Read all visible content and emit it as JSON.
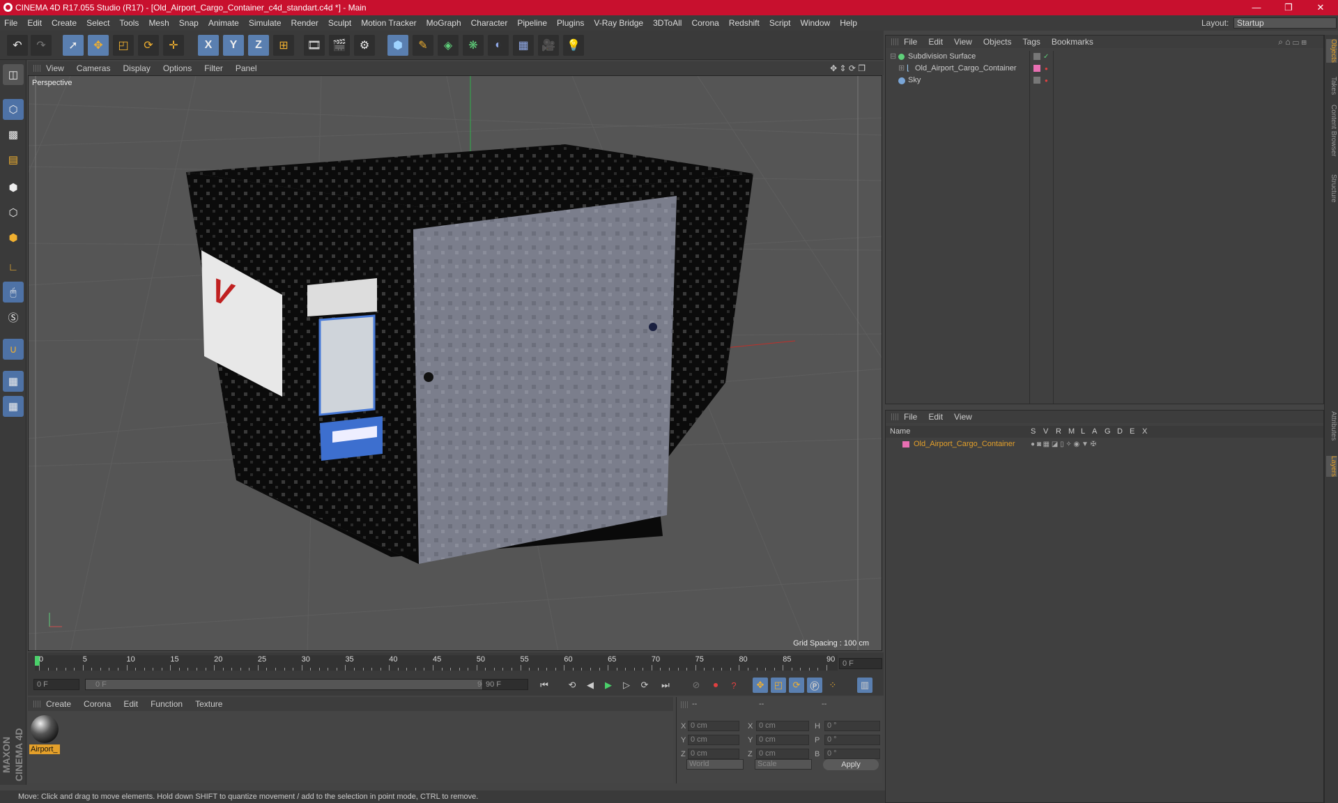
{
  "window": {
    "title": "CINEMA 4D R17.055 Studio (R17) - [Old_Airport_Cargo_Container_c4d_standart.c4d *] - Main",
    "minimize": "—",
    "restore": "❐",
    "close": "✕"
  },
  "menu": [
    "File",
    "Edit",
    "Create",
    "Select",
    "Tools",
    "Mesh",
    "Snap",
    "Animate",
    "Simulate",
    "Render",
    "Sculpt",
    "Motion Tracker",
    "MoGraph",
    "Character",
    "Pipeline",
    "Plugins",
    "V-Ray Bridge",
    "3DToAll",
    "Corona",
    "Redshift",
    "Script",
    "Window",
    "Help"
  ],
  "layout": {
    "label": "Layout:",
    "value": "Startup"
  },
  "toolbar": {
    "x_label": "X",
    "y_label": "Y",
    "z_label": "Z"
  },
  "viewport": {
    "menu": [
      "View",
      "Cameras",
      "Display",
      "Options",
      "Filter",
      "Panel"
    ],
    "camera_label": "Perspective",
    "grid_spacing": "Grid Spacing : 100 cm"
  },
  "timeline": {
    "ticks": [
      "0",
      "5",
      "10",
      "15",
      "20",
      "25",
      "30",
      "35",
      "40",
      "45",
      "50",
      "55",
      "60",
      "65",
      "70",
      "75",
      "80",
      "85",
      "90"
    ],
    "current_frame": "0 F",
    "start_field": "0 F",
    "range_start": "0 F",
    "range_end": "90 F",
    "end_field": "90 F"
  },
  "material_manager": {
    "menu": [
      "Create",
      "Corona",
      "Edit",
      "Function",
      "Texture"
    ],
    "material_name": "Airport_"
  },
  "coordinates": {
    "header": [
      "--",
      "--",
      "--"
    ],
    "rows": [
      {
        "axis": "X",
        "pos": "0 cm",
        "axis2": "X",
        "size": "0 cm",
        "rot_axis": "H",
        "rot": "0 °"
      },
      {
        "axis": "Y",
        "pos": "0 cm",
        "axis2": "Y",
        "size": "0 cm",
        "rot_axis": "P",
        "rot": "0 °"
      },
      {
        "axis": "Z",
        "pos": "0 cm",
        "axis2": "Z",
        "size": "0 cm",
        "rot_axis": "B",
        "rot": "0 °"
      }
    ],
    "world_select": "World",
    "scale_select": "Scale",
    "apply_label": "Apply"
  },
  "status": "Move: Click and drag to move elements. Hold down SHIFT to quantize movement / add to the selection in point mode, CTRL to remove.",
  "object_manager": {
    "menu": [
      "File",
      "Edit",
      "View",
      "Objects",
      "Tags",
      "Bookmarks"
    ],
    "objects": [
      {
        "name": "Subdivision Surface"
      },
      {
        "name": "Old_Airport_Cargo_Container"
      },
      {
        "name": "Sky"
      }
    ]
  },
  "layer_manager": {
    "menu": [
      "File",
      "Edit",
      "View"
    ],
    "columns": [
      "Name",
      "S",
      "V",
      "R",
      "M",
      "L",
      "A",
      "G",
      "D",
      "E",
      "X"
    ],
    "layer_name": "Old_Airport_Cargo_Container"
  },
  "right_tabs": [
    "Objects",
    "Takes",
    "Content Browser",
    "Structure",
    "Attributes",
    "Layers"
  ],
  "maxon_logo": "MAXON CINEMA 4D",
  "colors": {
    "title_red": "#c8102e",
    "accent_orange": "#e4a02a",
    "tool_blue": "#5a7fb0",
    "layer_pink": "#e86fb2"
  }
}
